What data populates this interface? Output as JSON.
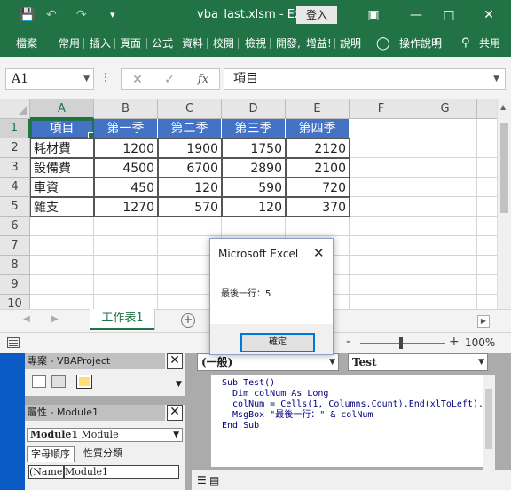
{
  "titlebar": {
    "filename": "vba_last.xlsm",
    "separator": "-",
    "app": "Excel",
    "login_label": "登入",
    "save_glyph": "💾",
    "undo_glyph": "↶",
    "redo_glyph": "↷",
    "qat_glyph": "▾"
  },
  "ribbon": {
    "tabs": [
      "檔案",
      "常用",
      "插入",
      "頁面",
      "公式",
      "資料",
      "校閱",
      "檢視",
      "開發",
      "增益",
      "說明"
    ],
    "tell_me": "操作說明",
    "share": "共用"
  },
  "formula_bar": {
    "name_box": "A1",
    "cancel_glyph": "✕",
    "enter_glyph": "✓",
    "fx_label": "fx",
    "value": "項目"
  },
  "grid": {
    "columns": [
      "A",
      "B",
      "C",
      "D",
      "E",
      "F",
      "G"
    ],
    "rows": [
      "1",
      "2",
      "3",
      "4",
      "5",
      "6",
      "7",
      "8",
      "9",
      "10"
    ],
    "header": [
      "項目",
      "第一季",
      "第二季",
      "第三季",
      "第四季"
    ],
    "data": [
      [
        "耗材費",
        "1200",
        "1900",
        "1750",
        "2120"
      ],
      [
        "設備費",
        "4500",
        "6700",
        "2890",
        "2100"
      ],
      [
        "車資",
        "450",
        "120",
        "590",
        "720"
      ],
      [
        "雜支",
        "1270",
        "570",
        "120",
        "370"
      ]
    ],
    "header_color": "#4472c4",
    "accent_color": "#217346"
  },
  "sheet_tabs": {
    "active": "工作表1",
    "add_glyph": "+"
  },
  "status_bar": {
    "zoom": "100%",
    "zoom_minus": "-",
    "zoom_plus": "+"
  },
  "dialog": {
    "title": "Microsoft Excel",
    "message": "最後一行：5",
    "ok_label": "確定",
    "close_glyph": "✕"
  },
  "vbe": {
    "project_title": "專案 - VBAProject",
    "properties_title": "屬性 - Module1",
    "object_name": "Module1",
    "object_type": "Module",
    "tab_alpha": "字母順序",
    "tab_category": "性質分類",
    "prop_name": "(Name)",
    "prop_value": "Module1",
    "object_combo": "(一般)",
    "proc_combo": "Test",
    "code": [
      "Sub Test()",
      "  Dim colNum As Long",
      "  colNum = Cells(1, Columns.Count).End(xlToLeft).",
      "  MsgBox \"最後一行：\" & colNum",
      "End Sub"
    ]
  }
}
